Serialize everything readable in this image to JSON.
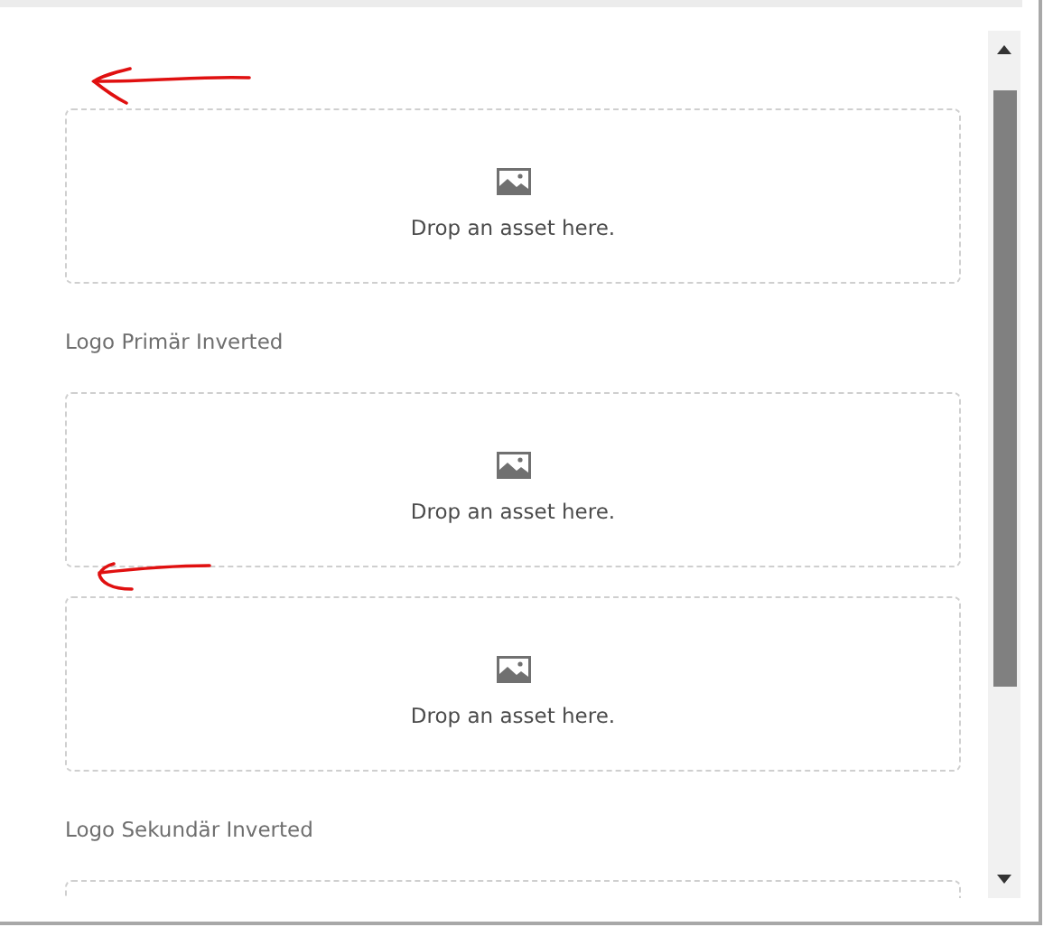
{
  "items": [
    {
      "kind": "arrow"
    },
    {
      "kind": "dropzone",
      "hint": "Drop an asset here."
    },
    {
      "kind": "label",
      "text": "Logo Primär Inverted"
    },
    {
      "kind": "dropzone",
      "hint": "Drop an asset here."
    },
    {
      "kind": "arrow"
    },
    {
      "kind": "dropzone",
      "hint": "Drop an asset here."
    },
    {
      "kind": "label",
      "text": "Logo Sekundär Inverted"
    },
    {
      "kind": "dropzone"
    }
  ]
}
